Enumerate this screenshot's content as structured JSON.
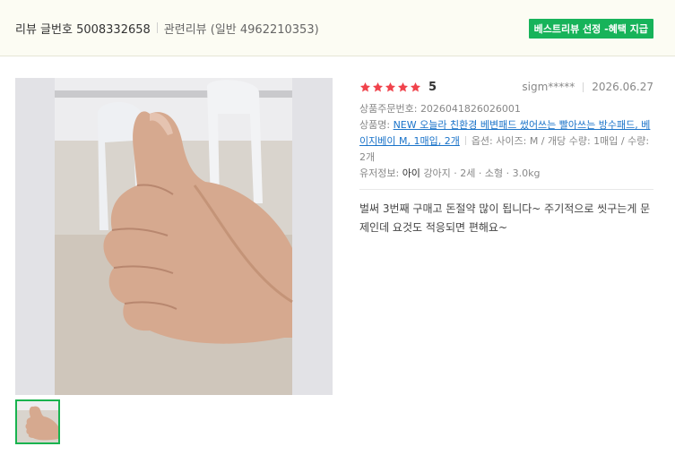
{
  "header": {
    "review_number_label": "리뷰 글번호 5008332658",
    "related_review_label": "관련리뷰 (일반 4962210353)",
    "best_badge": "베스트리뷰 선정 -혜택 지급"
  },
  "review": {
    "stars": 5,
    "score": "5",
    "user": "sigm*****",
    "date": "2026.06.27",
    "order_label": "상품주문번호:",
    "order_number": "2026041826026001",
    "product_label": "상품명:",
    "product_name": "NEW 오늘라 친환경 베변패드 썼어쓰는 빨아쓰는 방수패드, 베이지베이 M, 1매입, 2개",
    "option_text": "옵션: 사이즈: M / 개당 수량: 1매입 / 수량: 2개",
    "pet_label": "유저정보:",
    "pet_name": "아이",
    "pet_info": "강아지 · 2세 · 소형 · 3.0kg",
    "content": "벌써 3번째 구매고 돈절약 많이 됩니다~ 주기적으로 씻구는게 문제인데 요것도 적응되면 편해요~"
  },
  "colors": {
    "star": "#f0434c",
    "badge_bg": "#17b35a",
    "link": "#1a73c9",
    "thumb_border": "#19b34f"
  },
  "icons": {
    "star": "star-icon"
  }
}
